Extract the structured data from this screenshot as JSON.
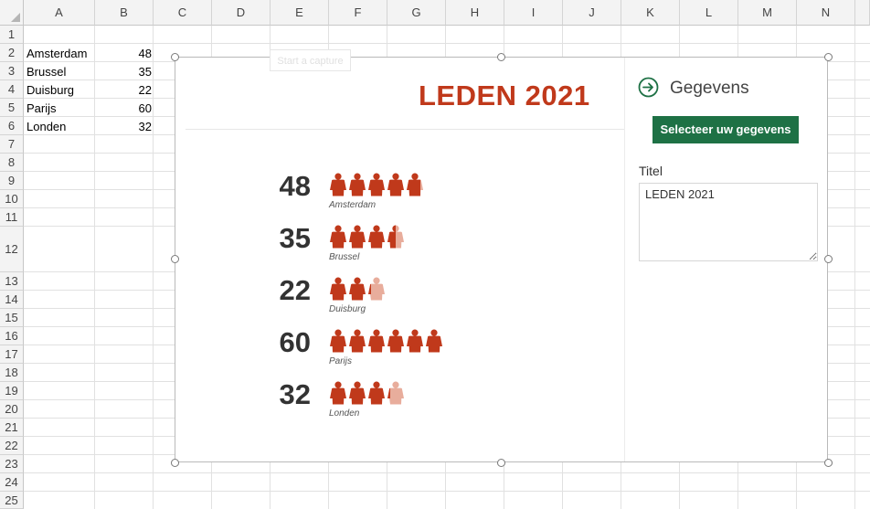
{
  "columns": [
    "A",
    "B",
    "C",
    "D",
    "E",
    "F",
    "G",
    "H",
    "I",
    "J",
    "K",
    "L",
    "M",
    "N"
  ],
  "rows": [
    "1",
    "2",
    "3",
    "4",
    "5",
    "6",
    "7",
    "8",
    "9",
    "10",
    "11",
    "12",
    "13",
    "14",
    "15",
    "16",
    "17",
    "18",
    "19",
    "20",
    "21",
    "22",
    "23",
    "24",
    "25"
  ],
  "cells": [
    {
      "city": "Amsterdam",
      "value": "48"
    },
    {
      "city": "Brussel",
      "value": "35"
    },
    {
      "city": "Duisburg",
      "value": "22"
    },
    {
      "city": "Parijs",
      "value": "60"
    },
    {
      "city": "Londen",
      "value": "32"
    }
  ],
  "ghost_button": "Start a capture",
  "chart_data": {
    "type": "pictograph",
    "title": "LEDEN 2021",
    "unit_per_icon": 10,
    "categories": [
      "Amsterdam",
      "Brussel",
      "Duisburg",
      "Parijs",
      "Londen"
    ],
    "values": [
      48,
      35,
      22,
      60,
      32
    ],
    "value_labels": [
      "48",
      "35",
      "22",
      "60",
      "32"
    ],
    "colors": {
      "full": "#c0391b",
      "partial": "#e8ad9c"
    }
  },
  "panel": {
    "heading": "Gegevens",
    "select_button": "Selecteer uw gegevens",
    "title_label": "Titel",
    "title_value": "LEDEN 2021"
  },
  "icons": {
    "panel_arrow": "arrow-right-circle-icon",
    "figure": "person-icon"
  },
  "colors": {
    "accent_green": "#1e7145",
    "title_red": "#c0391b"
  }
}
